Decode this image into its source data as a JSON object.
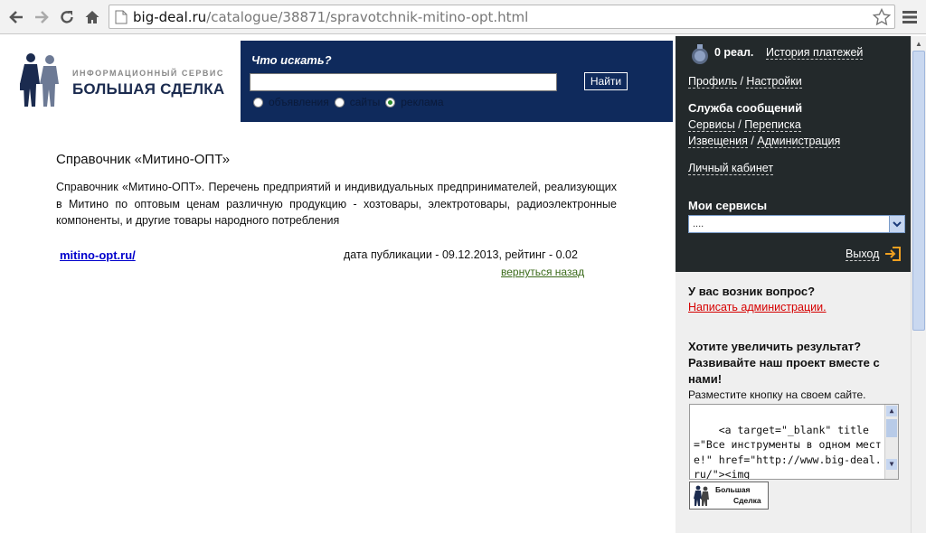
{
  "browser": {
    "url_host": "big-deal.ru",
    "url_path": "/catalogue/38871/spravotchnik-mitino-opt.html"
  },
  "logo": {
    "subtitle": "ИНФОРМАЦИОННЫЙ СЕРВИС",
    "title": "БОЛЬШАЯ СДЕЛКА"
  },
  "search": {
    "label": "Что искать?",
    "value": "",
    "button": "Найти",
    "options": [
      {
        "label": "объявления",
        "selected": false
      },
      {
        "label": "сайты",
        "selected": false
      },
      {
        "label": "реклама",
        "selected": true
      }
    ]
  },
  "main": {
    "title": "Справочник «Митино-ОПТ»",
    "description": "Справочник «Митино-ОПТ». Перечень предприятий и индивидуальных предпринимателей, реализующих в Митино по оптовым ценам различную продукцию - хозтовары, электротовары, радиоэлектронные компоненты, и другие товары народного потребления",
    "item_link": "mitino-opt.ru/",
    "item_meta": "дата публикации - 09.12.2013, рейтинг - 0.02",
    "back_link": "вернуться назад"
  },
  "account": {
    "balance": "0 реал.",
    "history": "История платежей",
    "profile": "Профиль",
    "separator": "/",
    "settings": "Настройки",
    "messages_title": "Служба сообщений",
    "services": "Сервисы",
    "correspondence": "Переписка",
    "notices": "Извещения",
    "administration": "Администрация",
    "cabinet": "Личный кабинет",
    "my_services_title": "Мои сервисы",
    "my_services_value": "....",
    "exit": "Выход"
  },
  "help": {
    "question": "У вас возник вопрос?",
    "write_admin": "Написать администрации.",
    "promo_title": "Хотите увеличить результат? Развивайте наш проект вместе с нами!",
    "promo_note": "Разместите кнопку на своем сайте.",
    "code": "<a target=\"_blank\" title=\"Все инструменты в одном месте!\" href=\"http://www.big-deal.ru/\"><img",
    "badge_line1": "Большая",
    "badge_line2": "Сделка"
  }
}
